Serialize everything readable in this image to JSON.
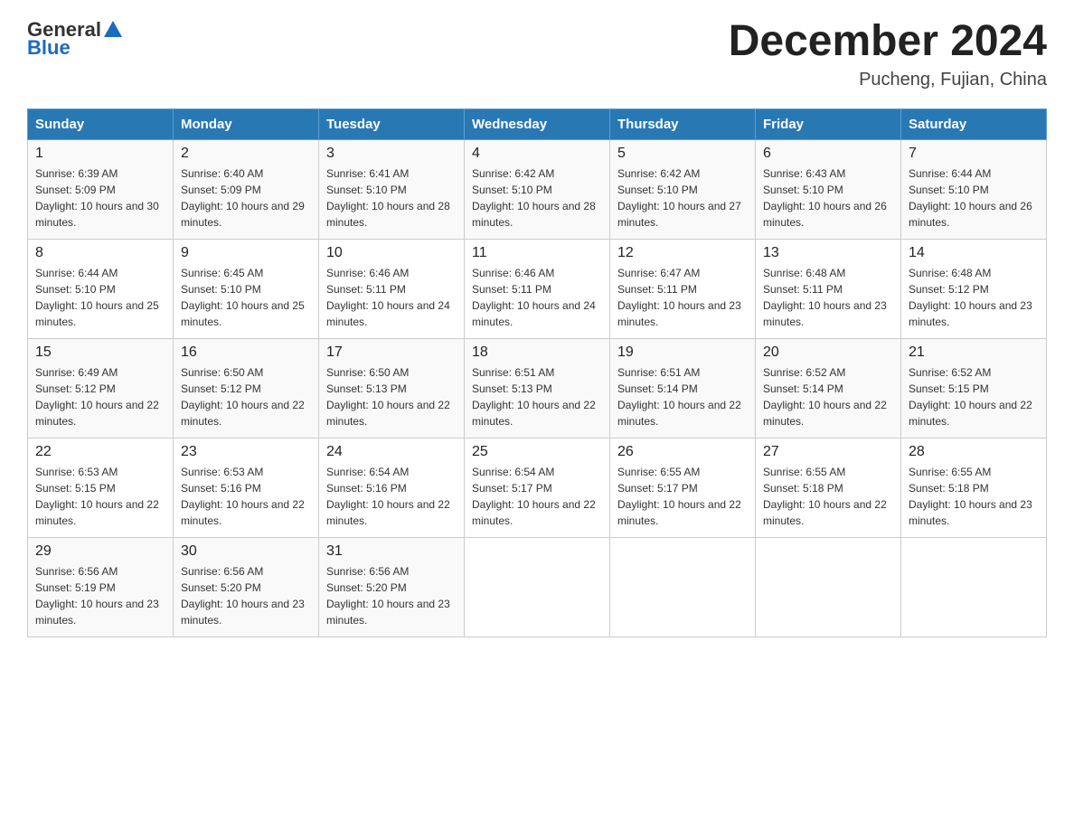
{
  "logo": {
    "general": "General",
    "blue": "Blue"
  },
  "title": "December 2024",
  "location": "Pucheng, Fujian, China",
  "headers": [
    "Sunday",
    "Monday",
    "Tuesday",
    "Wednesday",
    "Thursday",
    "Friday",
    "Saturday"
  ],
  "weeks": [
    [
      {
        "day": "1",
        "sunrise": "6:39 AM",
        "sunset": "5:09 PM",
        "daylight": "10 hours and 30 minutes."
      },
      {
        "day": "2",
        "sunrise": "6:40 AM",
        "sunset": "5:09 PM",
        "daylight": "10 hours and 29 minutes."
      },
      {
        "day": "3",
        "sunrise": "6:41 AM",
        "sunset": "5:10 PM",
        "daylight": "10 hours and 28 minutes."
      },
      {
        "day": "4",
        "sunrise": "6:42 AM",
        "sunset": "5:10 PM",
        "daylight": "10 hours and 28 minutes."
      },
      {
        "day": "5",
        "sunrise": "6:42 AM",
        "sunset": "5:10 PM",
        "daylight": "10 hours and 27 minutes."
      },
      {
        "day": "6",
        "sunrise": "6:43 AM",
        "sunset": "5:10 PM",
        "daylight": "10 hours and 26 minutes."
      },
      {
        "day": "7",
        "sunrise": "6:44 AM",
        "sunset": "5:10 PM",
        "daylight": "10 hours and 26 minutes."
      }
    ],
    [
      {
        "day": "8",
        "sunrise": "6:44 AM",
        "sunset": "5:10 PM",
        "daylight": "10 hours and 25 minutes."
      },
      {
        "day": "9",
        "sunrise": "6:45 AM",
        "sunset": "5:10 PM",
        "daylight": "10 hours and 25 minutes."
      },
      {
        "day": "10",
        "sunrise": "6:46 AM",
        "sunset": "5:11 PM",
        "daylight": "10 hours and 24 minutes."
      },
      {
        "day": "11",
        "sunrise": "6:46 AM",
        "sunset": "5:11 PM",
        "daylight": "10 hours and 24 minutes."
      },
      {
        "day": "12",
        "sunrise": "6:47 AM",
        "sunset": "5:11 PM",
        "daylight": "10 hours and 23 minutes."
      },
      {
        "day": "13",
        "sunrise": "6:48 AM",
        "sunset": "5:11 PM",
        "daylight": "10 hours and 23 minutes."
      },
      {
        "day": "14",
        "sunrise": "6:48 AM",
        "sunset": "5:12 PM",
        "daylight": "10 hours and 23 minutes."
      }
    ],
    [
      {
        "day": "15",
        "sunrise": "6:49 AM",
        "sunset": "5:12 PM",
        "daylight": "10 hours and 22 minutes."
      },
      {
        "day": "16",
        "sunrise": "6:50 AM",
        "sunset": "5:12 PM",
        "daylight": "10 hours and 22 minutes."
      },
      {
        "day": "17",
        "sunrise": "6:50 AM",
        "sunset": "5:13 PM",
        "daylight": "10 hours and 22 minutes."
      },
      {
        "day": "18",
        "sunrise": "6:51 AM",
        "sunset": "5:13 PM",
        "daylight": "10 hours and 22 minutes."
      },
      {
        "day": "19",
        "sunrise": "6:51 AM",
        "sunset": "5:14 PM",
        "daylight": "10 hours and 22 minutes."
      },
      {
        "day": "20",
        "sunrise": "6:52 AM",
        "sunset": "5:14 PM",
        "daylight": "10 hours and 22 minutes."
      },
      {
        "day": "21",
        "sunrise": "6:52 AM",
        "sunset": "5:15 PM",
        "daylight": "10 hours and 22 minutes."
      }
    ],
    [
      {
        "day": "22",
        "sunrise": "6:53 AM",
        "sunset": "5:15 PM",
        "daylight": "10 hours and 22 minutes."
      },
      {
        "day": "23",
        "sunrise": "6:53 AM",
        "sunset": "5:16 PM",
        "daylight": "10 hours and 22 minutes."
      },
      {
        "day": "24",
        "sunrise": "6:54 AM",
        "sunset": "5:16 PM",
        "daylight": "10 hours and 22 minutes."
      },
      {
        "day": "25",
        "sunrise": "6:54 AM",
        "sunset": "5:17 PM",
        "daylight": "10 hours and 22 minutes."
      },
      {
        "day": "26",
        "sunrise": "6:55 AM",
        "sunset": "5:17 PM",
        "daylight": "10 hours and 22 minutes."
      },
      {
        "day": "27",
        "sunrise": "6:55 AM",
        "sunset": "5:18 PM",
        "daylight": "10 hours and 22 minutes."
      },
      {
        "day": "28",
        "sunrise": "6:55 AM",
        "sunset": "5:18 PM",
        "daylight": "10 hours and 23 minutes."
      }
    ],
    [
      {
        "day": "29",
        "sunrise": "6:56 AM",
        "sunset": "5:19 PM",
        "daylight": "10 hours and 23 minutes."
      },
      {
        "day": "30",
        "sunrise": "6:56 AM",
        "sunset": "5:20 PM",
        "daylight": "10 hours and 23 minutes."
      },
      {
        "day": "31",
        "sunrise": "6:56 AM",
        "sunset": "5:20 PM",
        "daylight": "10 hours and 23 minutes."
      },
      null,
      null,
      null,
      null
    ]
  ]
}
